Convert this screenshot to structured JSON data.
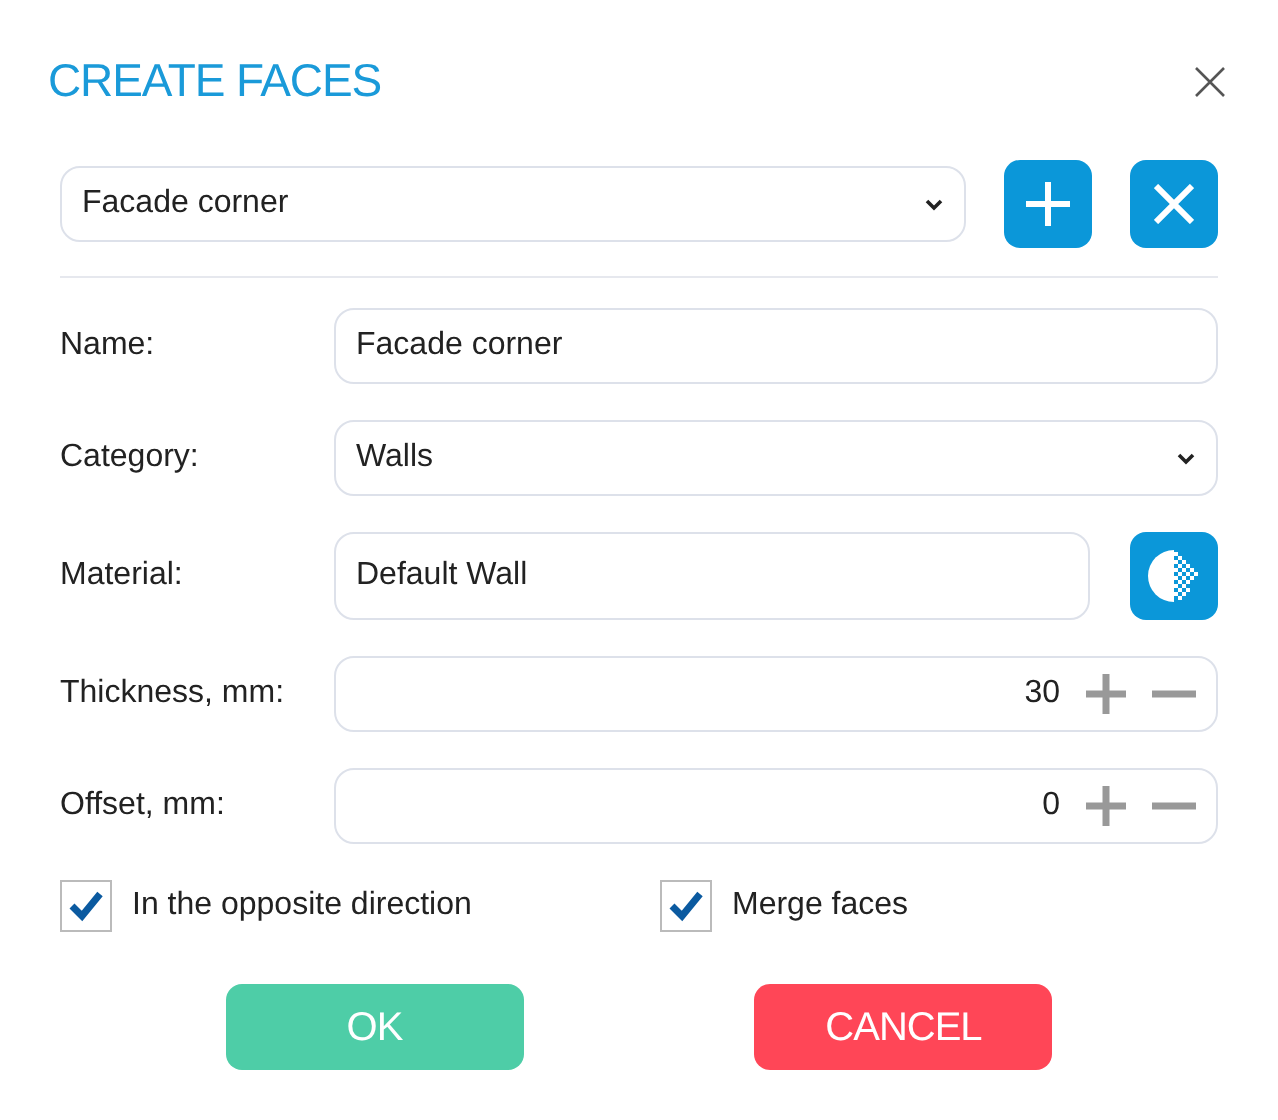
{
  "dialog": {
    "title": "CREATE FACES"
  },
  "preset": {
    "value": "Facade corner"
  },
  "fields": [
    {
      "kind": "text",
      "label": "Name:",
      "value": "Facade corner"
    },
    {
      "kind": "select",
      "label": "Category:",
      "value": "Walls"
    },
    {
      "kind": "material",
      "label": "Material:",
      "value": "Default Wall"
    },
    {
      "kind": "number",
      "label": "Thickness, mm:",
      "value": "30"
    },
    {
      "kind": "number",
      "label": "Offset, mm:",
      "value": "0"
    }
  ],
  "checkboxes": [
    {
      "label": "In the opposite direction",
      "checked": true
    },
    {
      "label": "Merge faces",
      "checked": true
    }
  ],
  "buttons": [
    {
      "kind": "ok",
      "label": "OK"
    },
    {
      "kind": "cancel",
      "label": "CANCEL"
    }
  ]
}
